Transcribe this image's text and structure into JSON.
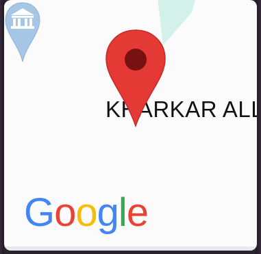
{
  "map": {
    "place_label": "KHARKAR ALLE",
    "logo": {
      "letters": [
        "G",
        "o",
        "o",
        "g",
        "l",
        "e"
      ],
      "colors": [
        "#4285F4",
        "#EA4335",
        "#FBBC05",
        "#4285F4",
        "#34A853",
        "#EA4335"
      ]
    },
    "pin_color": "#E53935",
    "poi_color": "#A6C6E6",
    "water_color": "#D2F0EA"
  }
}
